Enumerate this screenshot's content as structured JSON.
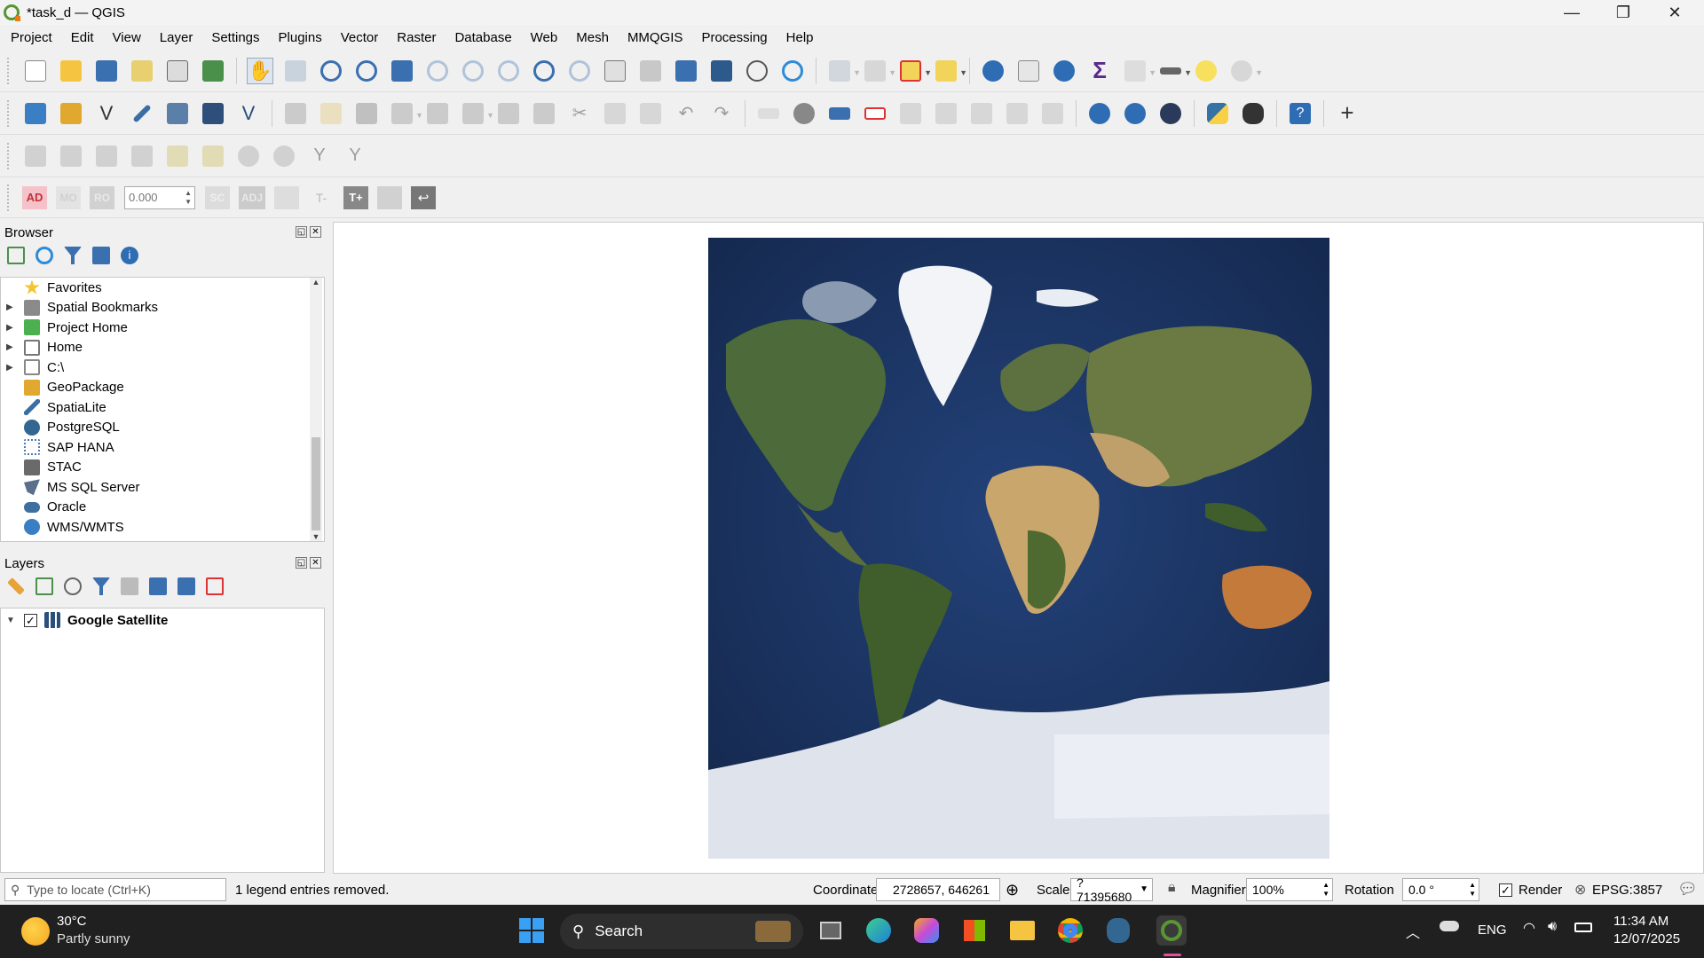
{
  "window": {
    "title": "*task_d — QGIS",
    "minimize": "—",
    "maximize": "❐",
    "close": "✕"
  },
  "menu": [
    {
      "label": "Project"
    },
    {
      "label": "Edit"
    },
    {
      "label": "View"
    },
    {
      "label": "Layer"
    },
    {
      "label": "Settings"
    },
    {
      "label": "Plugins"
    },
    {
      "label": "Vector"
    },
    {
      "label": "Raster"
    },
    {
      "label": "Database"
    },
    {
      "label": "Web"
    },
    {
      "label": "Mesh"
    },
    {
      "label": "MMQGIS"
    },
    {
      "label": "Processing"
    },
    {
      "label": "Help"
    }
  ],
  "advanced_digitizing": {
    "ad": "AD",
    "mo": "MO",
    "ro": "RO",
    "value": "0.000",
    "sc": "SC",
    "adj": "ADJ",
    "t_minus": "T-",
    "t_plus": "T+"
  },
  "browser": {
    "title": "Browser",
    "items": [
      {
        "label": "Favorites",
        "icon": "star-icon",
        "expandable": false,
        "color": "#f4c430"
      },
      {
        "label": "Spatial Bookmarks",
        "icon": "bookmark-icon",
        "expandable": true,
        "color": "#8a8a8a"
      },
      {
        "label": "Project Home",
        "icon": "project-home-icon",
        "expandable": true,
        "color": "#4caf50"
      },
      {
        "label": "Home",
        "icon": "home-icon",
        "expandable": true,
        "color": "#777777"
      },
      {
        "label": "C:\\",
        "icon": "drive-icon",
        "expandable": true,
        "color": "#888888"
      },
      {
        "label": "GeoPackage",
        "icon": "geopackage-icon",
        "expandable": false,
        "color": "#e0a82e"
      },
      {
        "label": "SpatiaLite",
        "icon": "spatialite-icon",
        "expandable": false,
        "color": "#3a6ea5"
      },
      {
        "label": "PostgreSQL",
        "icon": "postgresql-icon",
        "expandable": false,
        "color": "#336791"
      },
      {
        "label": "SAP HANA",
        "icon": "sap-hana-icon",
        "expandable": false,
        "color": "#4a7bb7"
      },
      {
        "label": "STAC",
        "icon": "stac-icon",
        "expandable": false,
        "color": "#6a6a6a"
      },
      {
        "label": "MS SQL Server",
        "icon": "mssql-icon",
        "expandable": false,
        "color": "#5a6f8a"
      },
      {
        "label": "Oracle",
        "icon": "oracle-icon",
        "expandable": false,
        "color": "#3d6fa0"
      },
      {
        "label": "WMS/WMTS",
        "icon": "wms-icon",
        "expandable": false,
        "color": "#3a7fc4"
      }
    ]
  },
  "layers": {
    "title": "Layers",
    "items": [
      {
        "label": "Google Satellite",
        "checked": true,
        "icon": "raster-layer-icon"
      }
    ]
  },
  "status": {
    "locate_placeholder": "Type to locate (Ctrl+K)",
    "message": "1 legend entries removed.",
    "coordinate_label": "Coordinate",
    "coordinate_value": "2728657, 646261",
    "scale_label": "Scale",
    "scale_value": "?71395680",
    "magnifier_label": "Magnifier",
    "magnifier_value": "100%",
    "rotation_label": "Rotation",
    "rotation_value": "0.0 °",
    "render_label": "Render",
    "render_checked": true,
    "crs": "EPSG:3857"
  },
  "taskbar": {
    "weather_temp": "30°C",
    "weather_desc": "Partly sunny",
    "search": "Search",
    "lang": "ENG",
    "time": "11:34 AM",
    "date": "12/07/2025"
  },
  "colors": {
    "accent": "#589632",
    "map_ocean": "#1e3563",
    "taskbar": "#202020"
  }
}
